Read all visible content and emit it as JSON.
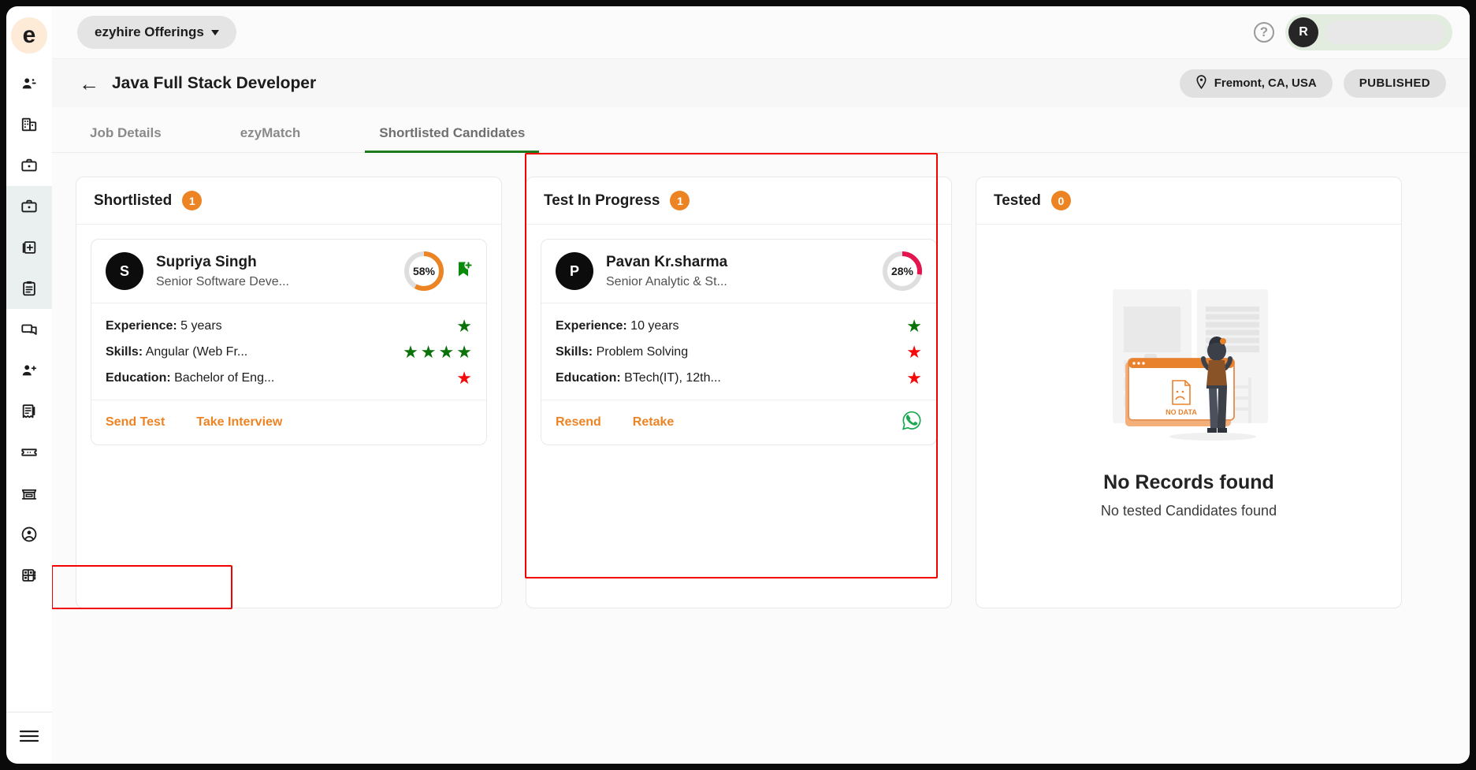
{
  "app": {
    "logo_letter": "e",
    "offerings_label": "ezyhire Offerings",
    "help_icon": "question-mark-icon",
    "user_initial": "R"
  },
  "sidebar": {
    "items": [
      {
        "icon": "people-group-icon",
        "active": false
      },
      {
        "icon": "building-company-icon",
        "active": false
      },
      {
        "icon": "briefcase-icon",
        "active": false
      },
      {
        "icon": "briefcase-jobs-icon",
        "active": true
      },
      {
        "icon": "add-document-icon",
        "active": true
      },
      {
        "icon": "clipboard-list-icon",
        "active": true
      },
      {
        "icon": "chat-bubble-icon",
        "active": false
      },
      {
        "icon": "add-person-icon",
        "active": false
      },
      {
        "icon": "invoice-receipt-icon",
        "active": false
      },
      {
        "icon": "ticket-icon",
        "active": false
      },
      {
        "icon": "storefront-icon",
        "active": false
      },
      {
        "icon": "user-circle-icon",
        "active": false
      },
      {
        "icon": "contact-book-icon",
        "active": false
      }
    ],
    "menu_icon": "hamburger-menu-icon"
  },
  "job_header": {
    "back_icon": "back-arrow-icon",
    "title": "Java Full Stack Developer",
    "location_icon": "location-pin-icon",
    "location": "Fremont, CA, USA",
    "status": "PUBLISHED"
  },
  "tabs": [
    {
      "label": "Job Details",
      "active": false
    },
    {
      "label": "ezyMatch",
      "active": false
    },
    {
      "label": "Shortlisted Candidates",
      "active": true
    }
  ],
  "columns": [
    {
      "title": "Shortlisted",
      "count": "1",
      "candidate": {
        "initial": "S",
        "name": "Supriya Singh",
        "role": "Senior Software Deve...",
        "percent": "58%",
        "percent_value": 58,
        "ring_color": "#ec8424",
        "flag_icon": "bookmark-add-icon",
        "details": [
          {
            "label": "Experience:",
            "value": "5 years",
            "stars": 1,
            "star_color": "green"
          },
          {
            "label": "Skills:",
            "value": "Angular (Web Fr...",
            "stars": 4,
            "star_color": "green"
          },
          {
            "label": "Education:",
            "value": "Bachelor of Eng...",
            "stars": 1,
            "star_color": "red"
          }
        ],
        "actions": [
          "Send Test",
          "Take Interview"
        ],
        "whatsapp": false
      }
    },
    {
      "title": "Test In Progress",
      "count": "1",
      "candidate": {
        "initial": "P",
        "name": "Pavan Kr.sharma",
        "role": "Senior Analytic & St...",
        "percent": "28%",
        "percent_value": 28,
        "ring_color": "#e4144e",
        "flag_icon": "",
        "details": [
          {
            "label": "Experience:",
            "value": "10 years",
            "stars": 1,
            "star_color": "green"
          },
          {
            "label": "Skills:",
            "value": "Problem Solving",
            "stars": 1,
            "star_color": "red"
          },
          {
            "label": "Education:",
            "value": "BTech(IT), 12th...",
            "stars": 1,
            "star_color": "red"
          }
        ],
        "actions": [
          "Resend",
          "Retake"
        ],
        "whatsapp": true,
        "whatsapp_icon": "whatsapp-icon"
      }
    },
    {
      "title": "Tested",
      "count": "0",
      "empty": {
        "illustration": "no-data-illustration",
        "illustration_caption": "NO DATA",
        "title": "No Records found",
        "subtitle": "No tested Candidates found"
      }
    }
  ],
  "colors": {
    "accent_orange": "#ec8424",
    "green": "#097209",
    "red": "#f40a0a",
    "crimson": "#e4144e",
    "tab_underline": "#1f7a1f",
    "highlight": "#f30000"
  }
}
